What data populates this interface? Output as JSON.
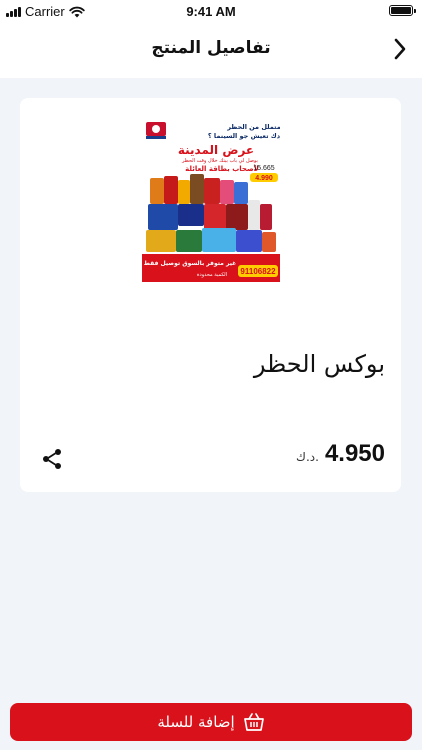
{
  "status_bar": {
    "carrier": "Carrier",
    "time": "9:41 AM"
  },
  "header": {
    "title": "تفاصيل المنتج",
    "back_icon": "chevron-right-icon"
  },
  "product": {
    "name": "بوكس الحظر",
    "price": "4.950",
    "currency": "د.ك.",
    "share_icon": "share-icon",
    "image": {
      "headline_top": "متملل من الحظر",
      "headline_sub": "ودك تعيش جو السينما ؟",
      "offer_title": "عرض المدينة",
      "delivery_line": "بوصل لي باب بيتك خلال وقت الحظر",
      "members_line": "لأصحاب بطاقة العائلة",
      "old_price": "15.665",
      "new_price": "4.990",
      "phone": "91106822",
      "note": "غير متوفر بالسوق توصيل فقط",
      "limited": "الكمية محدودة"
    }
  },
  "cart_button": {
    "label": "إضافة للسلة",
    "icon": "basket-icon"
  },
  "colors": {
    "accent": "#d8111b",
    "background": "#f1f4f8",
    "card": "#ffffff"
  }
}
